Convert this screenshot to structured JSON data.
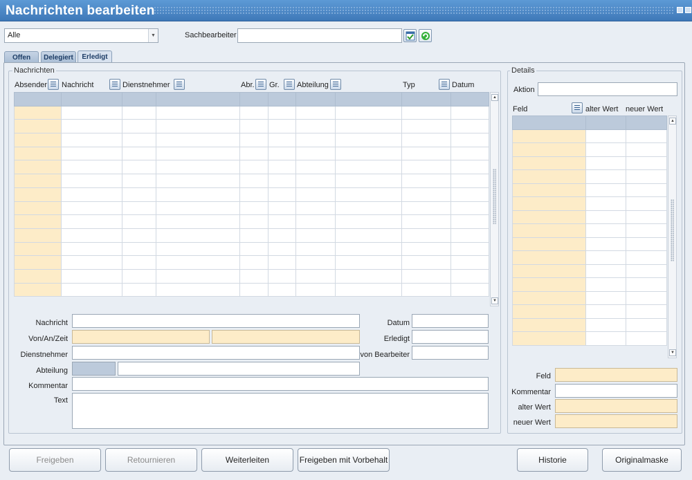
{
  "window": {
    "title": "Nachrichten bearbeiten"
  },
  "filter": {
    "selected": "Alle",
    "sachbearbeiter_label": "Sachbearbeiter",
    "sachbearbeiter_value": ""
  },
  "tabs": [
    {
      "label": "Offen"
    },
    {
      "label": "Delegiert"
    },
    {
      "label": "Erledigt"
    }
  ],
  "nachrichten": {
    "group_label": "Nachrichten",
    "columns": [
      "Absender",
      "Nachricht",
      "Dienstnehmer",
      "Abr.",
      "Gr.",
      "Abteilung",
      "Typ",
      "Datum"
    ],
    "rows": 14
  },
  "form": {
    "nachricht_label": "Nachricht",
    "vonanzeit_label": "Von/An/Zeit",
    "dienstnehmer_label": "Dienstnehmer",
    "abteilung_label": "Abteilung",
    "kommentar_label": "Kommentar",
    "text_label": "Text",
    "datum_label": "Datum",
    "erledigt_label": "Erledigt",
    "vonbearbeiter_label": "von Bearbeiter"
  },
  "details": {
    "group_label": "Details",
    "aktion_label": "Aktion",
    "columns": [
      "Feld",
      "alter Wert",
      "neuer Wert"
    ],
    "rows": 16,
    "feld_label": "Feld",
    "kommentar_label": "Kommentar",
    "alter_wert_label": "alter Wert",
    "neuer_wert_label": "neuer Wert"
  },
  "buttons": {
    "freigeben": "Freigeben",
    "retournieren": "Retournieren",
    "weiterleiten": "Weiterleiten",
    "freigeben_vorbehalt": "Freigeben mit Vorbehalt",
    "historie": "Historie",
    "originalmaske": "Originalmaske"
  },
  "icons": [
    "confirm-icon",
    "refresh-icon",
    "column-config-icon"
  ],
  "colors": {
    "titlebar": "#3e78b8",
    "header_row": "#bccadb",
    "highlight": "#fdecc8"
  }
}
